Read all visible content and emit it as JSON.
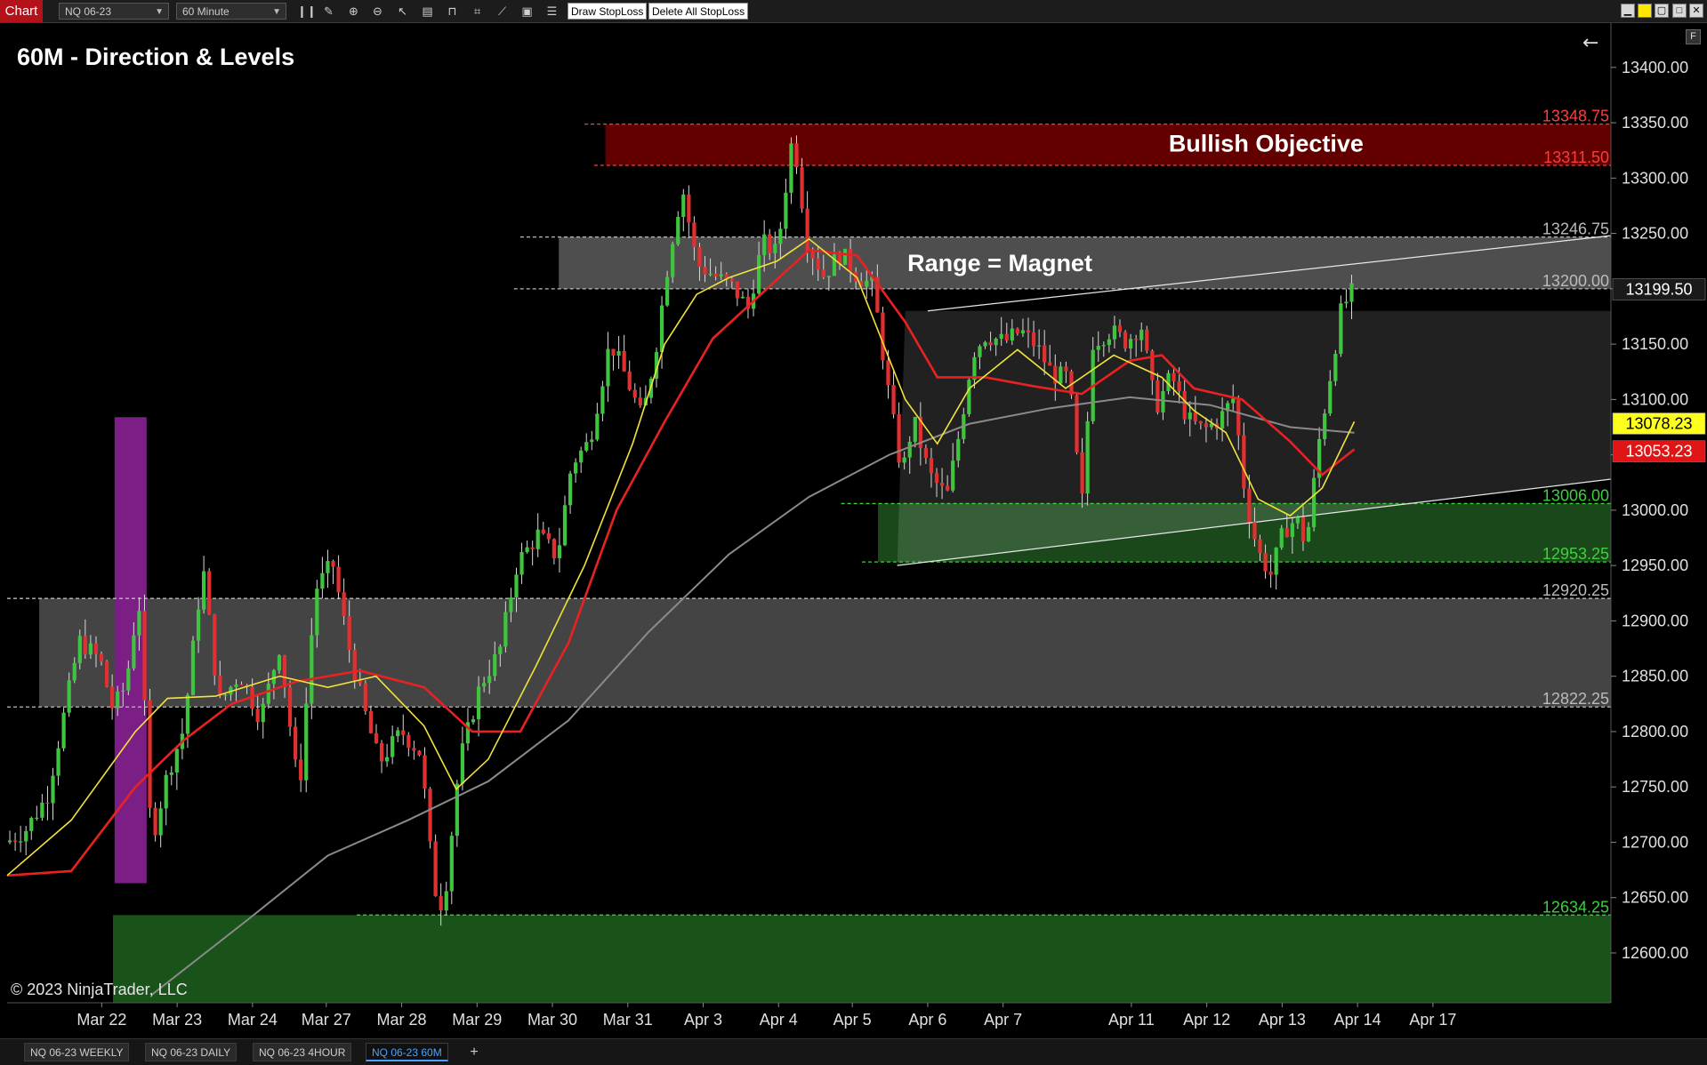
{
  "window": {
    "tag": "Chart",
    "instrument": "NQ 06-23",
    "interval": "60 Minute",
    "draw_button": "Draw StopLoss",
    "delete_button": "Delete All StopLoss",
    "f_label": "F"
  },
  "tabs": [
    {
      "label": "NQ 06-23 WEEKLY",
      "active": false
    },
    {
      "label": "NQ 06-23 DAILY",
      "active": false
    },
    {
      "label": "NQ 06-23 4HOUR",
      "active": false
    },
    {
      "label": "NQ 06-23 60M",
      "active": true
    }
  ],
  "add_tab": "+",
  "chart_data": {
    "type": "candlestick",
    "title": "60M - Direction & Levels",
    "copyright": "© 2023 NinjaTrader, LLC",
    "ylim": [
      12555,
      13440
    ],
    "yticks": [
      12600,
      12650,
      12700,
      12750,
      12800,
      12850,
      12900,
      12950,
      13000,
      13050,
      13100,
      13150,
      13200,
      13250,
      13300,
      13350,
      13400
    ],
    "ytick_labels": [
      "12600.00",
      "12650.00",
      "12700.00",
      "12750.00",
      "12800.00",
      "12850.00",
      "12900.00",
      "12950.00",
      "13000.00",
      "13050.00",
      "13100.00",
      "13150.00",
      "13200.00",
      "13250.00",
      "13300.00",
      "13350.00",
      "13400.00"
    ],
    "xticks": [
      "Mar 22",
      "Mar 23",
      "Mar 24",
      "Mar 27",
      "Mar 28",
      "Mar 29",
      "Mar 30",
      "Mar 31",
      "Apr 3",
      "Apr 4",
      "Apr 5",
      "Apr 6",
      "Apr 7",
      "Apr 11",
      "Apr 12",
      "Apr 13",
      "Apr 14",
      "Apr 17"
    ],
    "xtick_frac": [
      0.059,
      0.106,
      0.153,
      0.199,
      0.246,
      0.293,
      0.34,
      0.387,
      0.434,
      0.481,
      0.527,
      0.574,
      0.621,
      0.701,
      0.748,
      0.795,
      0.842,
      0.889
    ],
    "price_path": [
      [
        0.0,
        12700
      ],
      [
        0.012,
        12712
      ],
      [
        0.025,
        12742
      ],
      [
        0.035,
        12812
      ],
      [
        0.045,
        12882
      ],
      [
        0.058,
        12865
      ],
      [
        0.066,
        12820
      ],
      [
        0.074,
        12842
      ],
      [
        0.082,
        12922
      ],
      [
        0.09,
        12700
      ],
      [
        0.1,
        12762
      ],
      [
        0.11,
        12802
      ],
      [
        0.122,
        12950
      ],
      [
        0.132,
        12825
      ],
      [
        0.145,
        12852
      ],
      [
        0.158,
        12812
      ],
      [
        0.17,
        12878
      ],
      [
        0.182,
        12742
      ],
      [
        0.192,
        12928
      ],
      [
        0.203,
        12952
      ],
      [
        0.214,
        12870
      ],
      [
        0.224,
        12812
      ],
      [
        0.232,
        12772
      ],
      [
        0.246,
        12800
      ],
      [
        0.258,
        12780
      ],
      [
        0.266,
        12660
      ],
      [
        0.272,
        12640
      ],
      [
        0.282,
        12772
      ],
      [
        0.295,
        12842
      ],
      [
        0.307,
        12872
      ],
      [
        0.318,
        12952
      ],
      [
        0.331,
        12978
      ],
      [
        0.343,
        12958
      ],
      [
        0.352,
        13042
      ],
      [
        0.363,
        13062
      ],
      [
        0.376,
        13152
      ],
      [
        0.386,
        13120
      ],
      [
        0.396,
        13082
      ],
      [
        0.404,
        13142
      ],
      [
        0.413,
        13232
      ],
      [
        0.421,
        13292
      ],
      [
        0.43,
        13222
      ],
      [
        0.441,
        13212
      ],
      [
        0.452,
        13202
      ],
      [
        0.462,
        13182
      ],
      [
        0.471,
        13242
      ],
      [
        0.48,
        13232
      ],
      [
        0.49,
        13342
      ],
      [
        0.499,
        13242
      ],
      [
        0.509,
        13212
      ],
      [
        0.52,
        13232
      ],
      [
        0.53,
        13212
      ],
      [
        0.54,
        13202
      ],
      [
        0.55,
        13102
      ],
      [
        0.558,
        13032
      ],
      [
        0.565,
        13082
      ],
      [
        0.575,
        13032
      ],
      [
        0.586,
        13012
      ],
      [
        0.594,
        13072
      ],
      [
        0.602,
        13142
      ],
      [
        0.61,
        13158
      ],
      [
        0.622,
        13152
      ],
      [
        0.632,
        13162
      ],
      [
        0.642,
        13148
      ],
      [
        0.652,
        13122
      ],
      [
        0.662,
        13120
      ],
      [
        0.67,
        13002
      ],
      [
        0.677,
        13152
      ],
      [
        0.688,
        13162
      ],
      [
        0.698,
        13152
      ],
      [
        0.707,
        13168
      ],
      [
        0.716,
        13092
      ],
      [
        0.726,
        13122
      ],
      [
        0.736,
        13082
      ],
      [
        0.746,
        13072
      ],
      [
        0.756,
        13082
      ],
      [
        0.765,
        13102
      ],
      [
        0.772,
        13012
      ],
      [
        0.78,
        12962
      ],
      [
        0.788,
        12942
      ],
      [
        0.796,
        12982
      ],
      [
        0.804,
        12992
      ],
      [
        0.81,
        12968
      ],
      [
        0.818,
        13062
      ],
      [
        0.825,
        13122
      ],
      [
        0.832,
        13182
      ],
      [
        0.84,
        13200
      ]
    ],
    "ema_fast_path": [
      [
        0.0,
        12670
      ],
      [
        0.04,
        12720
      ],
      [
        0.08,
        12800
      ],
      [
        0.1,
        12830
      ],
      [
        0.13,
        12832
      ],
      [
        0.17,
        12850
      ],
      [
        0.2,
        12840
      ],
      [
        0.23,
        12850
      ],
      [
        0.26,
        12805
      ],
      [
        0.28,
        12748
      ],
      [
        0.3,
        12775
      ],
      [
        0.33,
        12860
      ],
      [
        0.36,
        12950
      ],
      [
        0.39,
        13060
      ],
      [
        0.41,
        13150
      ],
      [
        0.43,
        13195
      ],
      [
        0.45,
        13210
      ],
      [
        0.48,
        13225
      ],
      [
        0.5,
        13245
      ],
      [
        0.53,
        13210
      ],
      [
        0.56,
        13100
      ],
      [
        0.58,
        13060
      ],
      [
        0.6,
        13110
      ],
      [
        0.63,
        13145
      ],
      [
        0.66,
        13110
      ],
      [
        0.69,
        13140
      ],
      [
        0.72,
        13120
      ],
      [
        0.74,
        13090
      ],
      [
        0.76,
        13070
      ],
      [
        0.78,
        13010
      ],
      [
        0.8,
        12995
      ],
      [
        0.82,
        13020
      ],
      [
        0.84,
        13080
      ]
    ],
    "ema_slow_path": [
      [
        0.0,
        12670
      ],
      [
        0.04,
        12674
      ],
      [
        0.08,
        12750
      ],
      [
        0.11,
        12792
      ],
      [
        0.14,
        12825
      ],
      [
        0.18,
        12845
      ],
      [
        0.22,
        12855
      ],
      [
        0.26,
        12840
      ],
      [
        0.29,
        12800
      ],
      [
        0.32,
        12800
      ],
      [
        0.35,
        12880
      ],
      [
        0.38,
        13000
      ],
      [
        0.41,
        13080
      ],
      [
        0.44,
        13155
      ],
      [
        0.47,
        13195
      ],
      [
        0.5,
        13235
      ],
      [
        0.53,
        13230
      ],
      [
        0.56,
        13170
      ],
      [
        0.58,
        13120
      ],
      [
        0.61,
        13120
      ],
      [
        0.64,
        13112
      ],
      [
        0.67,
        13105
      ],
      [
        0.7,
        13135
      ],
      [
        0.72,
        13140
      ],
      [
        0.74,
        13110
      ],
      [
        0.77,
        13100
      ],
      [
        0.8,
        13062
      ],
      [
        0.82,
        13032
      ],
      [
        0.84,
        13055
      ]
    ],
    "sma_long_path": [
      [
        0.09,
        12562
      ],
      [
        0.15,
        12630
      ],
      [
        0.2,
        12688
      ],
      [
        0.25,
        12720
      ],
      [
        0.3,
        12755
      ],
      [
        0.35,
        12810
      ],
      [
        0.4,
        12890
      ],
      [
        0.45,
        12960
      ],
      [
        0.5,
        13012
      ],
      [
        0.55,
        13050
      ],
      [
        0.6,
        13078
      ],
      [
        0.65,
        13092
      ],
      [
        0.7,
        13102
      ],
      [
        0.75,
        13095
      ],
      [
        0.8,
        13075
      ],
      [
        0.84,
        13070
      ]
    ],
    "level_bars": [
      {
        "frac": 0.077,
        "low": 12663,
        "high": 13084,
        "color": "#7b1f86"
      }
    ],
    "zones": [
      {
        "name": "bullish-objective-zone",
        "low": 13311.5,
        "high": 13348.75,
        "x0": 0.373,
        "x1": 1.0,
        "color": "#6a0000"
      },
      {
        "name": "range-magnet-zone",
        "low": 13200,
        "high": 13246.75,
        "x0": 0.344,
        "x1": 1.0,
        "color": "#555555"
      },
      {
        "name": "lower-range-zone",
        "low": 12822.25,
        "high": 12920.25,
        "x0": 0.02,
        "x1": 1.0,
        "color": "#4a4a4a"
      },
      {
        "name": "apr13-support-zone",
        "low": 12953.25,
        "high": 13006,
        "x0": 0.543,
        "x1": 1.0,
        "color": "#1c4e1c"
      },
      {
        "name": "bottom-support-zone",
        "low": 12555,
        "high": 12634.25,
        "x0": 0.066,
        "x1": 1.0,
        "color": "#1c5a1c"
      }
    ],
    "levels": [
      {
        "value": 13348.75,
        "label": "13348.75",
        "color": "#ff3b3b",
        "x0": 0.36
      },
      {
        "value": 13311.5,
        "label": "13311.50",
        "color": "#ff3b3b",
        "x0": 0.366
      },
      {
        "value": 13246.75,
        "label": "13246.75",
        "color": "#bbbbbb",
        "x0": 0.32
      },
      {
        "value": 13200,
        "label": "13200.00",
        "color": "#bbbbbb",
        "x0": 0.316
      },
      {
        "value": 13006,
        "label": "13006.00",
        "color": "#3cd13c",
        "x0": 0.52
      },
      {
        "value": 12953.25,
        "label": "12953.25",
        "color": "#3cd13c",
        "x0": 0.533
      },
      {
        "value": 12920.25,
        "label": "12920.25",
        "color": "#bbbbbb",
        "x0": 0.0
      },
      {
        "value": 12822.25,
        "label": "12822.25",
        "color": "#bbbbbb",
        "x0": 0.0
      },
      {
        "value": 12634.25,
        "label": "12634.25",
        "color": "#3cd13c",
        "x0": 0.218
      }
    ],
    "channel": {
      "upper": [
        [
          0.574,
          13180
        ],
        [
          1.0,
          13248
        ]
      ],
      "lower": [
        [
          0.555,
          12950
        ],
        [
          1.0,
          13028
        ]
      ]
    },
    "annotations": [
      {
        "text": "Bullish Objective",
        "frac": 0.785,
        "value": 13331
      },
      {
        "text": "Range = Magnet",
        "frac": 0.619,
        "value": 13223
      }
    ],
    "price_markers": [
      {
        "value": 13199.5,
        "label": "13199.50",
        "bg": "#1a1a1a",
        "fg": "#ffffff"
      },
      {
        "value": 13078.23,
        "label": "13078.23",
        "bg": "#ffff1e",
        "fg": "#000000"
      },
      {
        "value": 13053.23,
        "label": "13053.23",
        "bg": "#e01515",
        "fg": "#ffffff"
      }
    ],
    "colors": {
      "up": "#3ec43e",
      "down": "#e03030",
      "ema_fast": "#f0e33a",
      "ema_slow": "#e82222",
      "sma_long": "#8a8a8a"
    }
  }
}
